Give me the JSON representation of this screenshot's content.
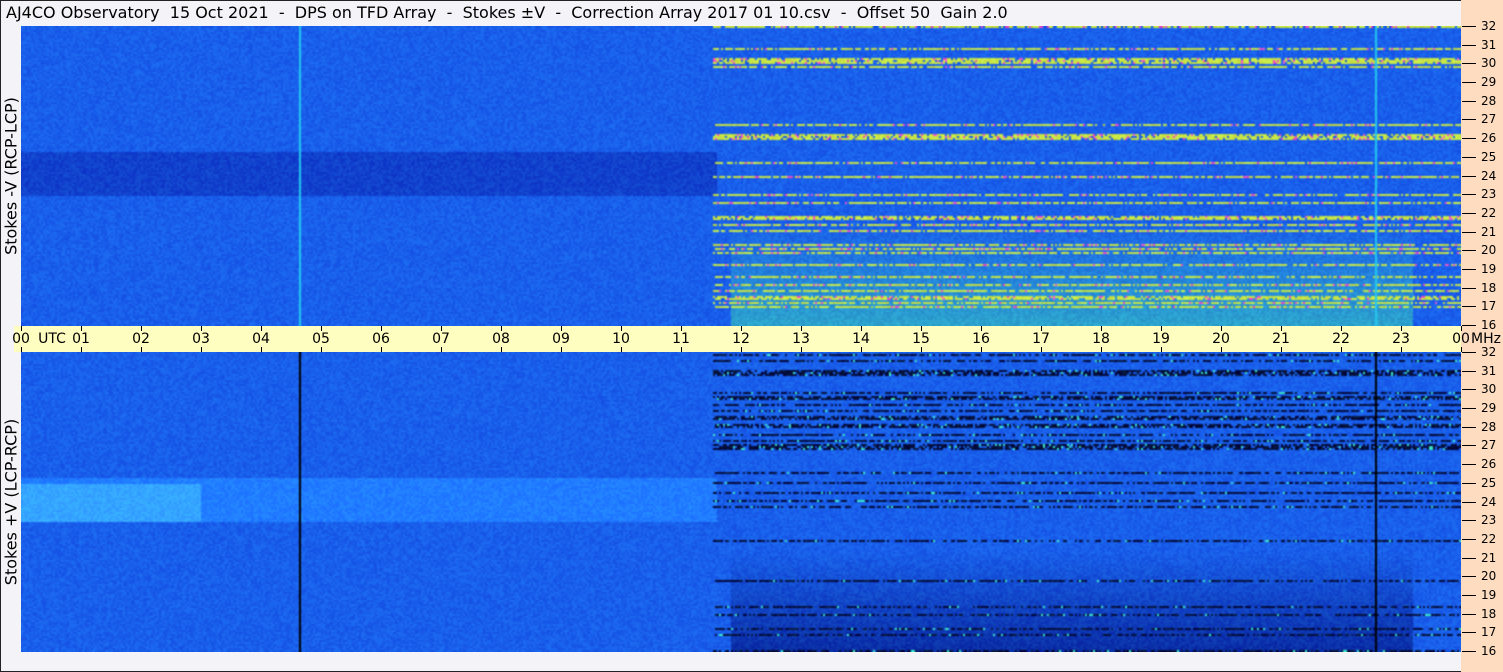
{
  "title": "AJ4CO Observatory  15 Oct 2021  -  DPS on TFD Array  -  Stokes ±V  -  Correction Array 2017 01 10.csv  -  Offset 50  Gain 2.0",
  "chart_data": {
    "type": "heatmap",
    "panels": [
      {
        "name": "top",
        "ylabel": "Stokes -V (RCP-LCP)",
        "vertical_markers_utc": [
          4.63,
          22.55
        ],
        "marker_color": "#22c8f0"
      },
      {
        "name": "bottom",
        "ylabel": "Stokes +V (LCP-RCP)",
        "vertical_markers_utc": [
          4.63,
          22.55
        ],
        "marker_color": "#000000"
      }
    ],
    "x_axis": {
      "unit_label": "UTC",
      "range": [
        0,
        24
      ],
      "tick_labels": [
        "00",
        "01",
        "02",
        "03",
        "04",
        "05",
        "06",
        "07",
        "08",
        "09",
        "10",
        "11",
        "12",
        "13",
        "14",
        "15",
        "16",
        "17",
        "18",
        "19",
        "20",
        "21",
        "22",
        "23",
        "00"
      ],
      "end_unit": "MHz"
    },
    "y_axis": {
      "unit": "MHz",
      "range": [
        16,
        32
      ],
      "tick_labels": [
        "32",
        "31",
        "30",
        "29",
        "28",
        "27",
        "26",
        "25",
        "24",
        "23",
        "22",
        "21",
        "20",
        "19",
        "18",
        "17",
        "16"
      ]
    },
    "colors": {
      "base": "#1a5ff0",
      "dark": "#0a3ab8",
      "bright": "#40e0a0",
      "highlight": "#f0f040",
      "background": "#f4f4f8",
      "axis_band": "#fefec0",
      "scale_band": "#fddcc0"
    }
  }
}
